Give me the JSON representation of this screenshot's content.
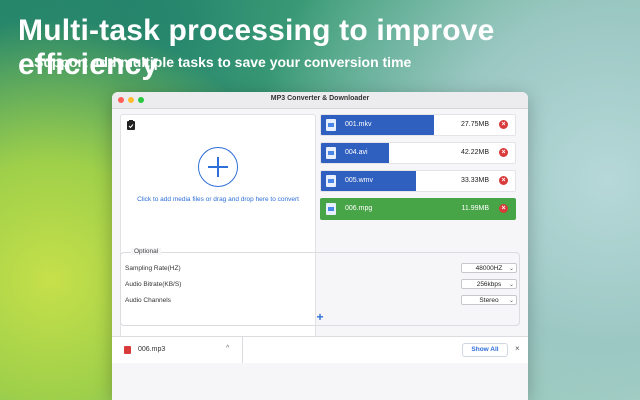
{
  "promo": {
    "headline": "Multi-task processing to improve efficiency",
    "subline": "Support add multiple tasks to save your conversion time"
  },
  "window": {
    "title": "MP3 Converter & Downloader"
  },
  "dropzone": {
    "text": "Click to add media files or drag and drop here to convert"
  },
  "files": [
    {
      "name": "001.mkv",
      "size": "27.75MB",
      "progress": 0.58,
      "status": "converting"
    },
    {
      "name": "004.avi",
      "size": "42.22MB",
      "progress": 0.35,
      "status": "converting"
    },
    {
      "name": "005.wmv",
      "size": "33.33MB",
      "progress": 0.49,
      "status": "converting"
    },
    {
      "name": "006.mpg",
      "size": "11.99MB",
      "progress": 1.0,
      "status": "done"
    }
  ],
  "optional": {
    "label": "Optional",
    "sampling_rate": {
      "label": "Sampling Rate(HZ)",
      "value": "48000HZ"
    },
    "audio_bitrate": {
      "label": "Audio Bitrate(KB/S)",
      "value": "256kbps"
    },
    "audio_channels": {
      "label": "Audio Channels",
      "value": "Stereo"
    },
    "add_symbol": "+"
  },
  "downloads": {
    "file_name": "006.mp3",
    "caret": "^",
    "show_all_label": "Show All",
    "close_symbol": "×"
  },
  "icons": {
    "remove": "×",
    "chevron": "⌄"
  },
  "colors": {
    "progress": "#2f5fbf",
    "done": "#47a447",
    "accent": "#2e6fd8",
    "remove": "#d93a3a"
  }
}
